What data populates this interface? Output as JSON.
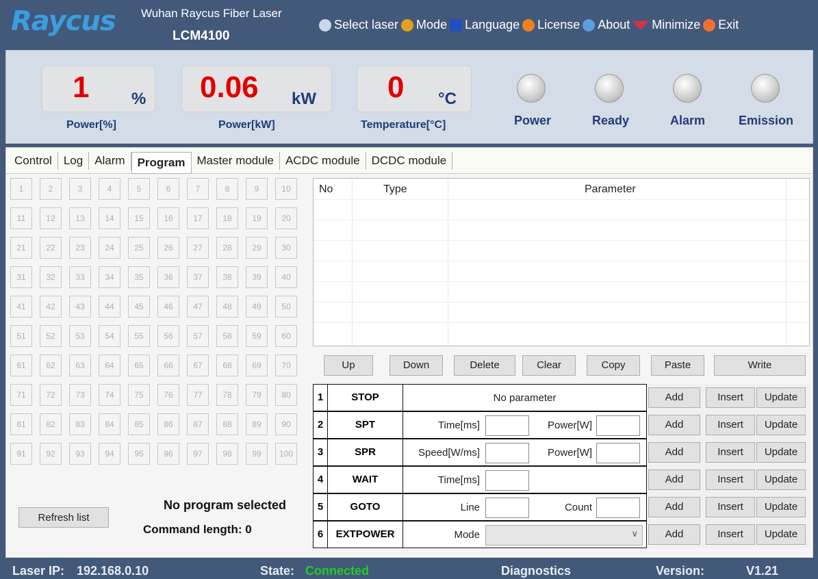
{
  "header": {
    "logo_text": "Raycus",
    "company": "Wuhan Raycus Fiber Laser",
    "model": "LCM4100",
    "menu": [
      {
        "label": "Select laser",
        "icon": "globe-icon",
        "color": "#c8d8e8"
      },
      {
        "label": "Mode",
        "icon": "users-icon",
        "color": "#e0a020"
      },
      {
        "label": "Language",
        "icon": "en-badge-icon",
        "color": "#2050c0"
      },
      {
        "label": "License",
        "icon": "key-icon",
        "color": "#f08020"
      },
      {
        "label": "About",
        "icon": "info-globe-icon",
        "color": "#5aa0e0"
      },
      {
        "label": "Minimize",
        "icon": "triangle-down-icon",
        "color": "#e03040"
      },
      {
        "label": "Exit",
        "icon": "close-circle-icon",
        "color": "#f07030"
      }
    ]
  },
  "status": {
    "power_pct": {
      "value": "1",
      "unit": "%",
      "label": "Power[%]"
    },
    "power_kw": {
      "value": "0.06",
      "unit": "kW",
      "label": "Power[kW]"
    },
    "temperature": {
      "value": "0",
      "unit": "°C",
      "label": "Temperature[°C]"
    },
    "indicators": [
      {
        "label": "Power"
      },
      {
        "label": "Ready"
      },
      {
        "label": "Alarm"
      },
      {
        "label": "Emission"
      }
    ]
  },
  "tabs": [
    "Control",
    "Log",
    "Alarm",
    "Program",
    "Master module",
    "ACDC module",
    "DCDC module"
  ],
  "active_tab": "Program",
  "program_slots": [
    "1",
    "2",
    "3",
    "4",
    "5",
    "6",
    "7",
    "8",
    "9",
    "10",
    "11",
    "12",
    "13",
    "14",
    "15",
    "16",
    "17",
    "18",
    "19",
    "20",
    "21",
    "22",
    "23",
    "24",
    "25",
    "26",
    "27",
    "28",
    "29",
    "30",
    "31",
    "32",
    "33",
    "34",
    "35",
    "36",
    "37",
    "38",
    "39",
    "40",
    "41",
    "42",
    "43",
    "44",
    "45",
    "46",
    "47",
    "48",
    "49",
    "50",
    "51",
    "52",
    "53",
    "54",
    "55",
    "56",
    "57",
    "58",
    "59",
    "60",
    "61",
    "62",
    "63",
    "64",
    "65",
    "66",
    "67",
    "68",
    "69",
    "70",
    "71",
    "72",
    "73",
    "74",
    "75",
    "76",
    "77",
    "78",
    "79",
    "80",
    "81",
    "82",
    "83",
    "84",
    "85",
    "86",
    "87",
    "88",
    "89",
    "90",
    "91",
    "92",
    "93",
    "94",
    "95",
    "96",
    "97",
    "98",
    "99",
    "100"
  ],
  "program_panel": {
    "refresh_label": "Refresh list",
    "no_program": "No program selected",
    "command_length": "Command length:  0"
  },
  "program_table": {
    "headers": {
      "no": "No",
      "type": "Type",
      "parameter": "Parameter"
    }
  },
  "edit_buttons": [
    "Up",
    "Down",
    "Delete",
    "Clear",
    "Copy",
    "Paste",
    "Write"
  ],
  "commands": [
    {
      "num": "1",
      "name": "STOP",
      "params": [
        {
          "center": "No parameter"
        }
      ]
    },
    {
      "num": "2",
      "name": "SPT",
      "params": [
        {
          "label": "Time[ms]"
        },
        {
          "label": "Power[W]"
        }
      ]
    },
    {
      "num": "3",
      "name": "SPR",
      "params": [
        {
          "label": "Speed[W/ms]"
        },
        {
          "label": "Power[W]"
        }
      ]
    },
    {
      "num": "4",
      "name": "WAIT",
      "params": [
        {
          "label": "Time[ms]"
        }
      ]
    },
    {
      "num": "5",
      "name": "GOTO",
      "params": [
        {
          "label": "Line"
        },
        {
          "label": "Count"
        }
      ]
    },
    {
      "num": "6",
      "name": "EXTPOWER",
      "params": [
        {
          "label": "Mode",
          "select": ""
        }
      ]
    }
  ],
  "command_buttons": [
    "Add",
    "Insert",
    "Update"
  ],
  "statusbar": {
    "ip_label": "Laser IP:",
    "ip_value": "192.168.0.10",
    "state_label": "State:",
    "state_value": "Connected",
    "state_color": "#22cc22",
    "diagnostics": "Diagnostics",
    "version_label": "Version:",
    "version_value": "V1.21"
  }
}
